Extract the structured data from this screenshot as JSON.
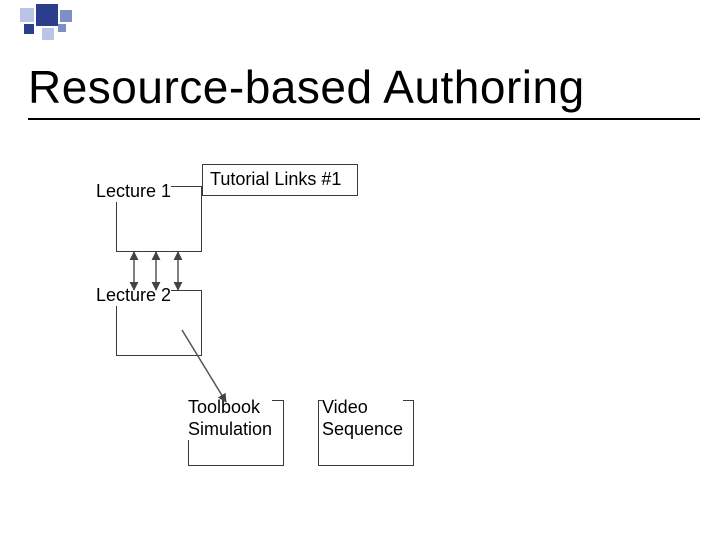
{
  "slide": {
    "title": "Resource-based Authoring"
  },
  "nodes": {
    "lecture1": "Lecture 1",
    "lecture2": "Lecture 2",
    "tutorial": "Tutorial Links #1",
    "toolbook": "Toolbook\nSimulation",
    "video": "Video\nSequence"
  }
}
